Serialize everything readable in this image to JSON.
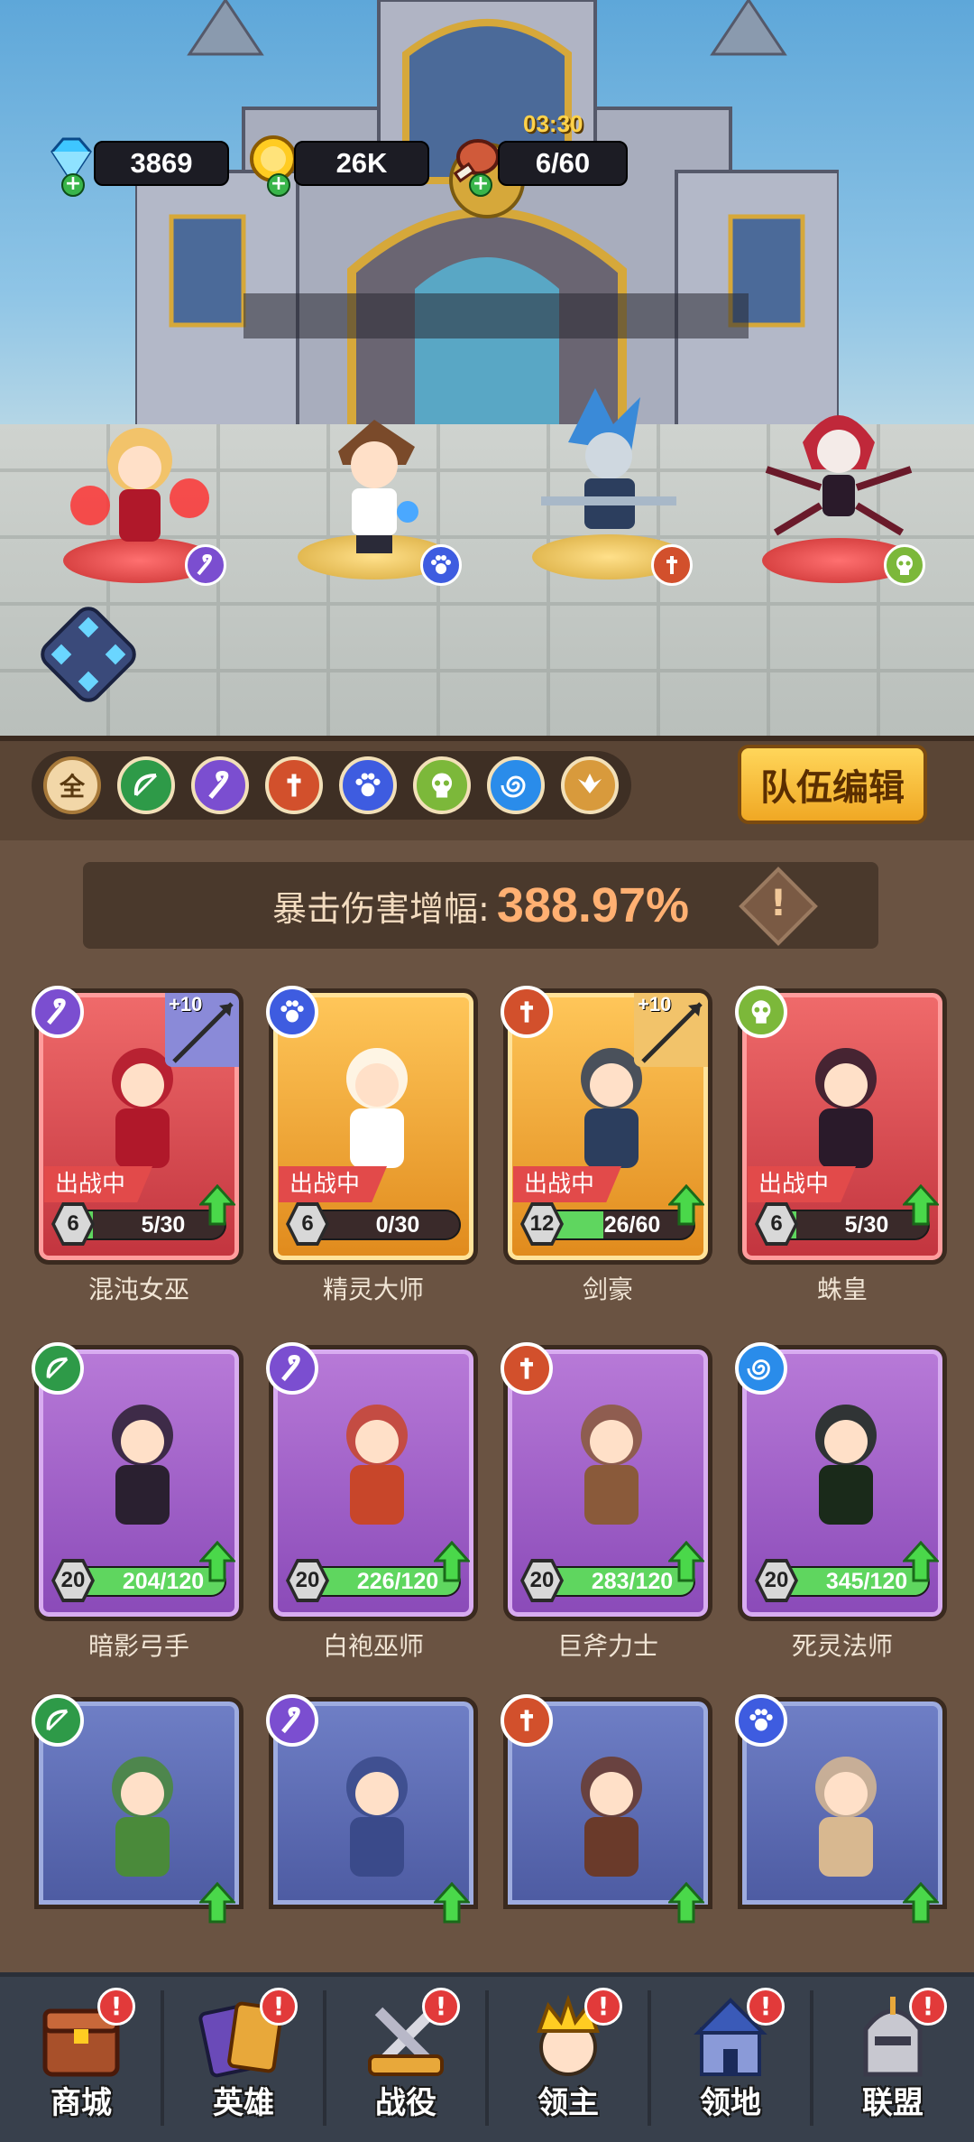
{
  "resources": {
    "gems": "3869",
    "gold": "26K",
    "stamina": "6/60",
    "stamina_timer": "03:30"
  },
  "filters": [
    {
      "name": "all",
      "glyph": "全",
      "color": "#f2d7a8"
    },
    {
      "name": "ranger",
      "glyph": "",
      "color": "#2e9a48"
    },
    {
      "name": "mage",
      "glyph": "",
      "color": "#7b4ed0"
    },
    {
      "name": "warrior",
      "glyph": "",
      "color": "#d2502c"
    },
    {
      "name": "beast",
      "glyph": "",
      "color": "#3e5ce0"
    },
    {
      "name": "undead",
      "glyph": "",
      "color": "#7cb83a"
    },
    {
      "name": "water",
      "glyph": "",
      "color": "#2a8cea"
    },
    {
      "name": "holy",
      "glyph": "",
      "color": "#d89a3c"
    }
  ],
  "team_edit_label": "队伍编辑",
  "crit": {
    "label": "暴击伤害增幅:",
    "value": "388.97%",
    "info_mark": "!"
  },
  "cards": [
    {
      "name": "混沌女巫",
      "type": "mage",
      "rarity": "red",
      "level": "6",
      "progress": "5/30",
      "fill": 0.17,
      "status": "出战中",
      "weapon": "+10"
    },
    {
      "name": "精灵大师",
      "type": "beast",
      "rarity": "gold",
      "level": "6",
      "progress": "0/30",
      "fill": 0.0,
      "status": "出战中",
      "weapon": ""
    },
    {
      "name": "剑豪",
      "type": "warrior",
      "rarity": "gold",
      "level": "12",
      "progress": "26/60",
      "fill": 0.43,
      "status": "出战中",
      "weapon": "+10"
    },
    {
      "name": "蛛皇",
      "type": "undead",
      "rarity": "red",
      "level": "6",
      "progress": "5/30",
      "fill": 0.17,
      "status": "出战中",
      "weapon": ""
    },
    {
      "name": "暗影弓手",
      "type": "ranger",
      "rarity": "purple",
      "level": "20",
      "progress": "204/120",
      "fill": 1.0,
      "status": "",
      "weapon": ""
    },
    {
      "name": "白袍巫师",
      "type": "mage",
      "rarity": "purple",
      "level": "20",
      "progress": "226/120",
      "fill": 1.0,
      "status": "",
      "weapon": ""
    },
    {
      "name": "巨斧力士",
      "type": "warrior",
      "rarity": "purple",
      "level": "20",
      "progress": "283/120",
      "fill": 1.0,
      "status": "",
      "weapon": ""
    },
    {
      "name": "死灵法师",
      "type": "water",
      "rarity": "purple",
      "level": "20",
      "progress": "345/120",
      "fill": 1.0,
      "status": "",
      "weapon": ""
    },
    {
      "name": "",
      "type": "ranger",
      "rarity": "blue",
      "level": "",
      "progress": "",
      "fill": 0,
      "status": "",
      "weapon": ""
    },
    {
      "name": "",
      "type": "mage",
      "rarity": "blue",
      "level": "",
      "progress": "",
      "fill": 0,
      "status": "",
      "weapon": ""
    },
    {
      "name": "",
      "type": "warrior",
      "rarity": "blue",
      "level": "",
      "progress": "",
      "fill": 0,
      "status": "",
      "weapon": ""
    },
    {
      "name": "",
      "type": "beast",
      "rarity": "blue",
      "level": "",
      "progress": "",
      "fill": 0,
      "status": "",
      "weapon": ""
    }
  ],
  "nav": [
    {
      "label": "商城",
      "icon": "shop-chest-icon",
      "alert": "!"
    },
    {
      "label": "英雄",
      "icon": "hero-cards-icon",
      "alert": "!"
    },
    {
      "label": "战役",
      "icon": "crossed-swords-icon",
      "alert": "!"
    },
    {
      "label": "领主",
      "icon": "lord-crown-icon",
      "alert": "!"
    },
    {
      "label": "领地",
      "icon": "castle-icon",
      "alert": "!"
    },
    {
      "label": "联盟",
      "icon": "knight-helmet-icon",
      "alert": "!"
    }
  ],
  "colors": {
    "gem": "#3ec6ff",
    "gold": "#ffcc22",
    "stamina": "#d05a3a",
    "panel": "#5a4535",
    "nav": "#38404c"
  }
}
